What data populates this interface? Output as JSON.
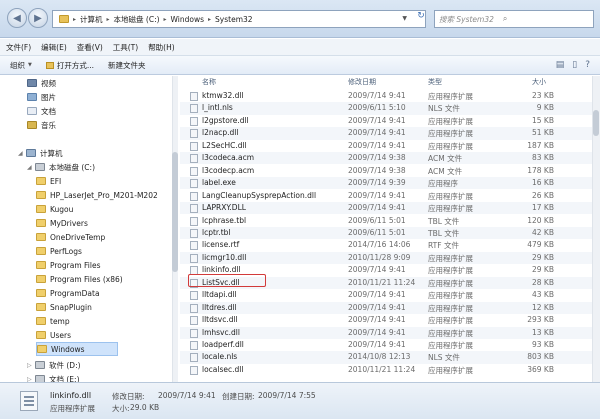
{
  "address": {
    "crumbs": [
      "计算机",
      "本地磁盘 (C:)",
      "Windows",
      "System32"
    ],
    "search_placeholder": "搜索 System32"
  },
  "menu": [
    "文件(F)",
    "编辑(E)",
    "查看(V)",
    "工具(T)",
    "帮助(H)"
  ],
  "toolbar": {
    "organize": "组织",
    "open_with": "打开方式...",
    "new_folder": "新建文件夹"
  },
  "sidebar": {
    "items": [
      {
        "label": "视频",
        "icon": "video-icon",
        "indent": 1
      },
      {
        "label": "图片",
        "icon": "image-icon",
        "indent": 1
      },
      {
        "label": "文档",
        "icon": "document-icon",
        "indent": 1
      },
      {
        "label": "音乐",
        "icon": "music-icon",
        "indent": 1
      },
      {
        "label": "计算机",
        "icon": "computer-icon",
        "indent": 0
      },
      {
        "label": "本地磁盘 (C:)",
        "icon": "drive-icon",
        "indent": 1
      },
      {
        "label": "EFI",
        "icon": "folder-icon",
        "indent": 2
      },
      {
        "label": "HP_LaserJet_Pro_M201-M202",
        "icon": "folder-icon",
        "indent": 2
      },
      {
        "label": "Kugou",
        "icon": "folder-icon",
        "indent": 2
      },
      {
        "label": "MyDrivers",
        "icon": "folder-icon",
        "indent": 2
      },
      {
        "label": "OneDriveTemp",
        "icon": "folder-icon",
        "indent": 2
      },
      {
        "label": "PerfLogs",
        "icon": "folder-icon",
        "indent": 2
      },
      {
        "label": "Program Files",
        "icon": "folder-icon",
        "indent": 2
      },
      {
        "label": "Program Files (x86)",
        "icon": "folder-icon",
        "indent": 2
      },
      {
        "label": "ProgramData",
        "icon": "folder-icon",
        "indent": 2
      },
      {
        "label": "SnapPlugin",
        "icon": "folder-icon",
        "indent": 2
      },
      {
        "label": "temp",
        "icon": "folder-icon",
        "indent": 2
      },
      {
        "label": "Users",
        "icon": "folder-icon",
        "indent": 2
      },
      {
        "label": "Windows",
        "icon": "folder-icon",
        "indent": 2,
        "selected": true
      },
      {
        "label": "软件 (D:)",
        "icon": "drive-icon",
        "indent": 1
      },
      {
        "label": "文档 (E:)",
        "icon": "drive-icon",
        "indent": 1
      }
    ]
  },
  "columns": {
    "name": "名称",
    "date": "修改日期",
    "type": "类型",
    "size": "大小"
  },
  "files": [
    {
      "name": "ktmw32.dll",
      "date": "2009/7/14 9:41",
      "type": "应用程序扩展",
      "size": "23 KB"
    },
    {
      "name": "l_intl.nls",
      "date": "2009/6/11 5:10",
      "type": "NLS 文件",
      "size": "9 KB"
    },
    {
      "name": "l2gpstore.dll",
      "date": "2009/7/14 9:41",
      "type": "应用程序扩展",
      "size": "15 KB"
    },
    {
      "name": "l2nacp.dll",
      "date": "2009/7/14 9:41",
      "type": "应用程序扩展",
      "size": "51 KB"
    },
    {
      "name": "L2SecHC.dll",
      "date": "2009/7/14 9:41",
      "type": "应用程序扩展",
      "size": "187 KB"
    },
    {
      "name": "l3codeca.acm",
      "date": "2009/7/14 9:38",
      "type": "ACM 文件",
      "size": "83 KB"
    },
    {
      "name": "l3codecp.acm",
      "date": "2009/7/14 9:38",
      "type": "ACM 文件",
      "size": "178 KB"
    },
    {
      "name": "label.exe",
      "date": "2009/7/14 9:39",
      "type": "应用程序",
      "size": "16 KB"
    },
    {
      "name": "LangCleanupSysprepAction.dll",
      "date": "2009/7/14 9:41",
      "type": "应用程序扩展",
      "size": "26 KB"
    },
    {
      "name": "LAPRXY.DLL",
      "date": "2009/7/14 9:41",
      "type": "应用程序扩展",
      "size": "17 KB"
    },
    {
      "name": "lcphrase.tbl",
      "date": "2009/6/11 5:01",
      "type": "TBL 文件",
      "size": "120 KB"
    },
    {
      "name": "lcptr.tbl",
      "date": "2009/6/11 5:01",
      "type": "TBL 文件",
      "size": "42 KB"
    },
    {
      "name": "license.rtf",
      "date": "2014/7/16 14:06",
      "type": "RTF 文件",
      "size": "479 KB"
    },
    {
      "name": "licmgr10.dll",
      "date": "2010/11/28 9:09",
      "type": "应用程序扩展",
      "size": "29 KB"
    },
    {
      "name": "linkinfo.dll",
      "date": "2009/7/14 9:41",
      "type": "应用程序扩展",
      "size": "29 KB"
    },
    {
      "name": "ListSvc.dll",
      "date": "2010/11/21 11:24",
      "type": "应用程序扩展",
      "size": "28 KB"
    },
    {
      "name": "lltdapi.dll",
      "date": "2009/7/14 9:41",
      "type": "应用程序扩展",
      "size": "43 KB"
    },
    {
      "name": "lltdres.dll",
      "date": "2009/7/14 9:41",
      "type": "应用程序扩展",
      "size": "12 KB"
    },
    {
      "name": "lltdsvc.dll",
      "date": "2009/7/14 9:41",
      "type": "应用程序扩展",
      "size": "293 KB"
    },
    {
      "name": "lmhsvc.dll",
      "date": "2009/7/14 9:41",
      "type": "应用程序扩展",
      "size": "13 KB"
    },
    {
      "name": "loadperf.dll",
      "date": "2009/7/14 9:41",
      "type": "应用程序扩展",
      "size": "93 KB"
    },
    {
      "name": "locale.nls",
      "date": "2014/10/8 12:13",
      "type": "NLS 文件",
      "size": "803 KB"
    },
    {
      "name": "localsec.dll",
      "date": "2010/11/21 11:24",
      "type": "应用程序扩展",
      "size": "369 KB"
    }
  ],
  "status": {
    "name": "linkinfo.dll",
    "type": "应用程序扩展",
    "modified_label": "修改日期:",
    "modified": "2009/7/14 9:41",
    "created_label": "创建日期:",
    "created": "2009/7/14 7:55",
    "size_label": "大小:",
    "size": "29.0 KB"
  }
}
